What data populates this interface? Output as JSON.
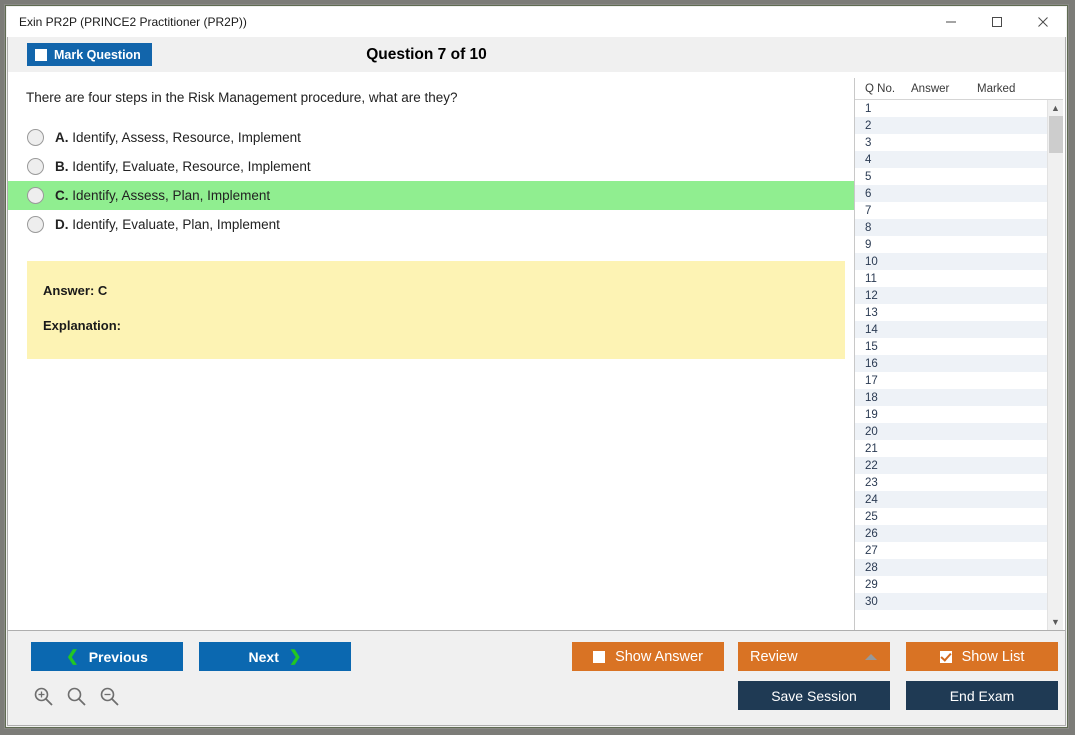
{
  "window": {
    "title": "Exin PR2P (PRINCE2 Practitioner (PR2P))",
    "minimize_label": "minimize-icon",
    "maximize_label": "maximize-icon",
    "close_label": "close-icon"
  },
  "header": {
    "mark_question_label": "Mark Question",
    "mark_question_checked": false,
    "question_counter": "Question 7 of 10"
  },
  "question": {
    "text": "There are four steps in the Risk Management procedure, what are they?",
    "options": [
      {
        "letter": "A.",
        "text": "Identify, Assess, Resource, Implement",
        "selected": false,
        "correct": false
      },
      {
        "letter": "B.",
        "text": "Identify, Evaluate, Resource, Implement",
        "selected": false,
        "correct": false
      },
      {
        "letter": "C.",
        "text": "Identify, Assess, Plan, Implement",
        "selected": false,
        "correct": true
      },
      {
        "letter": "D.",
        "text": "Identify, Evaluate, Plan, Implement",
        "selected": false,
        "correct": false
      }
    ]
  },
  "answer_panel": {
    "answer_label": "Answer: C",
    "explanation_label": "Explanation:",
    "background_color": "#fdf3b4"
  },
  "question_list": {
    "columns": [
      "Q No.",
      "Answer",
      "Marked"
    ],
    "rows": [
      {
        "qno": "1",
        "answer": "",
        "marked": ""
      },
      {
        "qno": "2",
        "answer": "",
        "marked": ""
      },
      {
        "qno": "3",
        "answer": "",
        "marked": ""
      },
      {
        "qno": "4",
        "answer": "",
        "marked": ""
      },
      {
        "qno": "5",
        "answer": "",
        "marked": ""
      },
      {
        "qno": "6",
        "answer": "",
        "marked": ""
      },
      {
        "qno": "7",
        "answer": "",
        "marked": ""
      },
      {
        "qno": "8",
        "answer": "",
        "marked": ""
      },
      {
        "qno": "9",
        "answer": "",
        "marked": ""
      },
      {
        "qno": "10",
        "answer": "",
        "marked": ""
      },
      {
        "qno": "11",
        "answer": "",
        "marked": ""
      },
      {
        "qno": "12",
        "answer": "",
        "marked": ""
      },
      {
        "qno": "13",
        "answer": "",
        "marked": ""
      },
      {
        "qno": "14",
        "answer": "",
        "marked": ""
      },
      {
        "qno": "15",
        "answer": "",
        "marked": ""
      },
      {
        "qno": "16",
        "answer": "",
        "marked": ""
      },
      {
        "qno": "17",
        "answer": "",
        "marked": ""
      },
      {
        "qno": "18",
        "answer": "",
        "marked": ""
      },
      {
        "qno": "19",
        "answer": "",
        "marked": ""
      },
      {
        "qno": "20",
        "answer": "",
        "marked": ""
      },
      {
        "qno": "21",
        "answer": "",
        "marked": ""
      },
      {
        "qno": "22",
        "answer": "",
        "marked": ""
      },
      {
        "qno": "23",
        "answer": "",
        "marked": ""
      },
      {
        "qno": "24",
        "answer": "",
        "marked": ""
      },
      {
        "qno": "25",
        "answer": "",
        "marked": ""
      },
      {
        "qno": "26",
        "answer": "",
        "marked": ""
      },
      {
        "qno": "27",
        "answer": "",
        "marked": ""
      },
      {
        "qno": "28",
        "answer": "",
        "marked": ""
      },
      {
        "qno": "29",
        "answer": "",
        "marked": ""
      },
      {
        "qno": "30",
        "answer": "",
        "marked": ""
      }
    ]
  },
  "toolbar": {
    "previous_label": "Previous",
    "next_label": "Next",
    "show_answer_label": "Show Answer",
    "show_answer_checked": false,
    "review_label": "Review",
    "show_list_label": "Show List",
    "show_list_checked": true,
    "save_session_label": "Save Session",
    "end_exam_label": "End Exam",
    "zoom_in_label": "zoom-in-icon",
    "zoom_reset_label": "zoom-reset-icon",
    "zoom_out_label": "zoom-out-icon"
  },
  "colors": {
    "primary_blue": "#0b68b0",
    "orange": "#d97324",
    "navy": "#1f3a54",
    "correct_green": "#90ee90",
    "answer_yellow": "#fdf3b4",
    "chevron_green": "#22c722"
  }
}
